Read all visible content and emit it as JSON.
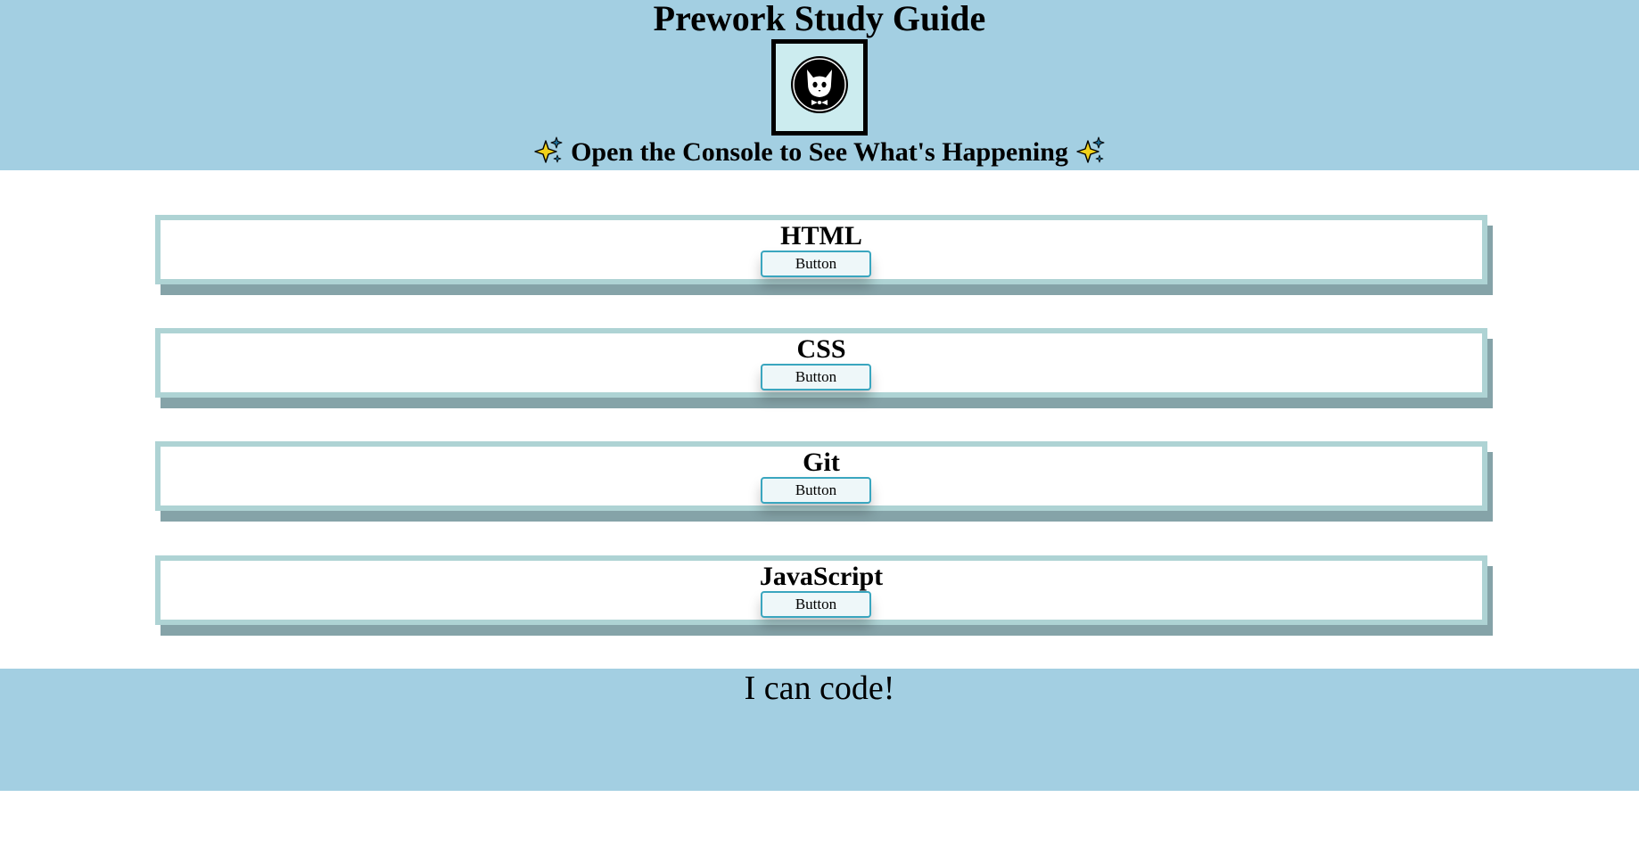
{
  "header": {
    "title": "Prework Study Guide",
    "avatar_icon": "cat-avatar-icon",
    "subtitle": "Open the Console to See What's Happening",
    "sparkle_icon": "sparkles-icon"
  },
  "cards": [
    {
      "title": "HTML",
      "button_label": "Button"
    },
    {
      "title": "CSS",
      "button_label": "Button"
    },
    {
      "title": "Git",
      "button_label": "Button"
    },
    {
      "title": "JavaScript",
      "button_label": "Button"
    }
  ],
  "footer": {
    "text": "I can code!"
  },
  "colors": {
    "header_bg": "#a3cfe2",
    "card_border": "#aed3d4",
    "card_shadow": "#85a3a8",
    "button_border": "#3aa6bf",
    "avatar_bg": "#ccecef"
  }
}
